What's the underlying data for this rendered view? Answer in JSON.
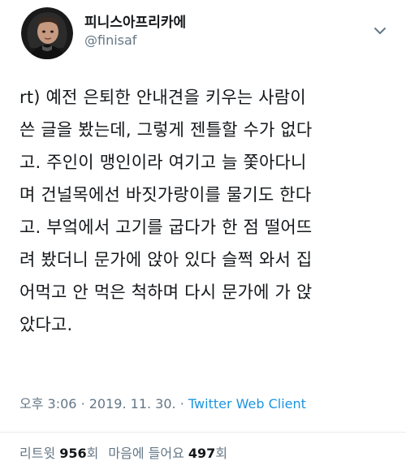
{
  "user": {
    "display_name": "피니스아프리카에",
    "handle": "@finisaf"
  },
  "tweet": {
    "lines": [
      "rt) 예전 은퇴한 안내견을 키우는 사람이",
      "쓴 글을 봤는데, 그렇게 젠틀할 수가 없다",
      "고. 주인이 맹인이라 여기고 늘 쫓아다니",
      "며 건널목에선 바짓가랑이를 물기도 한다",
      "고. 부엌에서 고기를 굽다가 한 점 떨어뜨",
      "려 봤더니 문가에 앉아 있다 슬쩍 와서 집",
      "어먹고 안 먹은 척하며 다시 문가에 가 앉",
      "았다고."
    ]
  },
  "meta": {
    "time": "오후 3:06",
    "separator1": "·",
    "date": "2019. 11. 30.",
    "separator2": "·",
    "source": "Twitter Web Client"
  },
  "stats": {
    "retweets_label": "리트윗",
    "retweets_count": "956",
    "retweets_suffix": "회",
    "likes_label": "마음에 들어요",
    "likes_count": "497",
    "likes_suffix": "회"
  },
  "icons": {
    "more": "chevron-down-icon"
  },
  "colors": {
    "text": "#14171a",
    "muted": "#657786",
    "link": "#1b95e0",
    "divider": "#e6ecf0"
  }
}
